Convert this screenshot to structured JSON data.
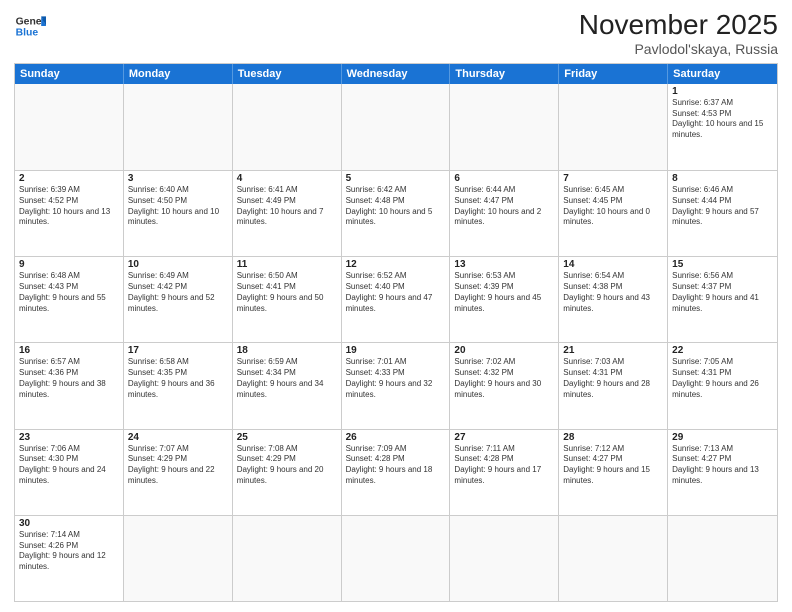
{
  "header": {
    "logo_text_general": "General",
    "logo_text_blue": "Blue",
    "title": "November 2025",
    "subtitle": "Pavlodol'skaya, Russia"
  },
  "days_of_week": [
    "Sunday",
    "Monday",
    "Tuesday",
    "Wednesday",
    "Thursday",
    "Friday",
    "Saturday"
  ],
  "weeks": [
    [
      {
        "day": "",
        "empty": true
      },
      {
        "day": "",
        "empty": true
      },
      {
        "day": "",
        "empty": true
      },
      {
        "day": "",
        "empty": true
      },
      {
        "day": "",
        "empty": true
      },
      {
        "day": "",
        "empty": true
      },
      {
        "day": "1",
        "sunrise": "6:37 AM",
        "sunset": "4:53 PM",
        "daylight": "10 hours and 15 minutes."
      }
    ],
    [
      {
        "day": "2",
        "sunrise": "6:39 AM",
        "sunset": "4:52 PM",
        "daylight": "10 hours and 13 minutes."
      },
      {
        "day": "3",
        "sunrise": "6:40 AM",
        "sunset": "4:50 PM",
        "daylight": "10 hours and 10 minutes."
      },
      {
        "day": "4",
        "sunrise": "6:41 AM",
        "sunset": "4:49 PM",
        "daylight": "10 hours and 7 minutes."
      },
      {
        "day": "5",
        "sunrise": "6:42 AM",
        "sunset": "4:48 PM",
        "daylight": "10 hours and 5 minutes."
      },
      {
        "day": "6",
        "sunrise": "6:44 AM",
        "sunset": "4:47 PM",
        "daylight": "10 hours and 2 minutes."
      },
      {
        "day": "7",
        "sunrise": "6:45 AM",
        "sunset": "4:45 PM",
        "daylight": "10 hours and 0 minutes."
      },
      {
        "day": "8",
        "sunrise": "6:46 AM",
        "sunset": "4:44 PM",
        "daylight": "9 hours and 57 minutes."
      }
    ],
    [
      {
        "day": "9",
        "sunrise": "6:48 AM",
        "sunset": "4:43 PM",
        "daylight": "9 hours and 55 minutes."
      },
      {
        "day": "10",
        "sunrise": "6:49 AM",
        "sunset": "4:42 PM",
        "daylight": "9 hours and 52 minutes."
      },
      {
        "day": "11",
        "sunrise": "6:50 AM",
        "sunset": "4:41 PM",
        "daylight": "9 hours and 50 minutes."
      },
      {
        "day": "12",
        "sunrise": "6:52 AM",
        "sunset": "4:40 PM",
        "daylight": "9 hours and 47 minutes."
      },
      {
        "day": "13",
        "sunrise": "6:53 AM",
        "sunset": "4:39 PM",
        "daylight": "9 hours and 45 minutes."
      },
      {
        "day": "14",
        "sunrise": "6:54 AM",
        "sunset": "4:38 PM",
        "daylight": "9 hours and 43 minutes."
      },
      {
        "day": "15",
        "sunrise": "6:56 AM",
        "sunset": "4:37 PM",
        "daylight": "9 hours and 41 minutes."
      }
    ],
    [
      {
        "day": "16",
        "sunrise": "6:57 AM",
        "sunset": "4:36 PM",
        "daylight": "9 hours and 38 minutes."
      },
      {
        "day": "17",
        "sunrise": "6:58 AM",
        "sunset": "4:35 PM",
        "daylight": "9 hours and 36 minutes."
      },
      {
        "day": "18",
        "sunrise": "6:59 AM",
        "sunset": "4:34 PM",
        "daylight": "9 hours and 34 minutes."
      },
      {
        "day": "19",
        "sunrise": "7:01 AM",
        "sunset": "4:33 PM",
        "daylight": "9 hours and 32 minutes."
      },
      {
        "day": "20",
        "sunrise": "7:02 AM",
        "sunset": "4:32 PM",
        "daylight": "9 hours and 30 minutes."
      },
      {
        "day": "21",
        "sunrise": "7:03 AM",
        "sunset": "4:31 PM",
        "daylight": "9 hours and 28 minutes."
      },
      {
        "day": "22",
        "sunrise": "7:05 AM",
        "sunset": "4:31 PM",
        "daylight": "9 hours and 26 minutes."
      }
    ],
    [
      {
        "day": "23",
        "sunrise": "7:06 AM",
        "sunset": "4:30 PM",
        "daylight": "9 hours and 24 minutes."
      },
      {
        "day": "24",
        "sunrise": "7:07 AM",
        "sunset": "4:29 PM",
        "daylight": "9 hours and 22 minutes."
      },
      {
        "day": "25",
        "sunrise": "7:08 AM",
        "sunset": "4:29 PM",
        "daylight": "9 hours and 20 minutes."
      },
      {
        "day": "26",
        "sunrise": "7:09 AM",
        "sunset": "4:28 PM",
        "daylight": "9 hours and 18 minutes."
      },
      {
        "day": "27",
        "sunrise": "7:11 AM",
        "sunset": "4:28 PM",
        "daylight": "9 hours and 17 minutes."
      },
      {
        "day": "28",
        "sunrise": "7:12 AM",
        "sunset": "4:27 PM",
        "daylight": "9 hours and 15 minutes."
      },
      {
        "day": "29",
        "sunrise": "7:13 AM",
        "sunset": "4:27 PM",
        "daylight": "9 hours and 13 minutes."
      }
    ],
    [
      {
        "day": "30",
        "sunrise": "7:14 AM",
        "sunset": "4:26 PM",
        "daylight": "9 hours and 12 minutes."
      },
      {
        "day": "",
        "empty": true
      },
      {
        "day": "",
        "empty": true
      },
      {
        "day": "",
        "empty": true
      },
      {
        "day": "",
        "empty": true
      },
      {
        "day": "",
        "empty": true
      },
      {
        "day": "",
        "empty": true
      }
    ]
  ]
}
